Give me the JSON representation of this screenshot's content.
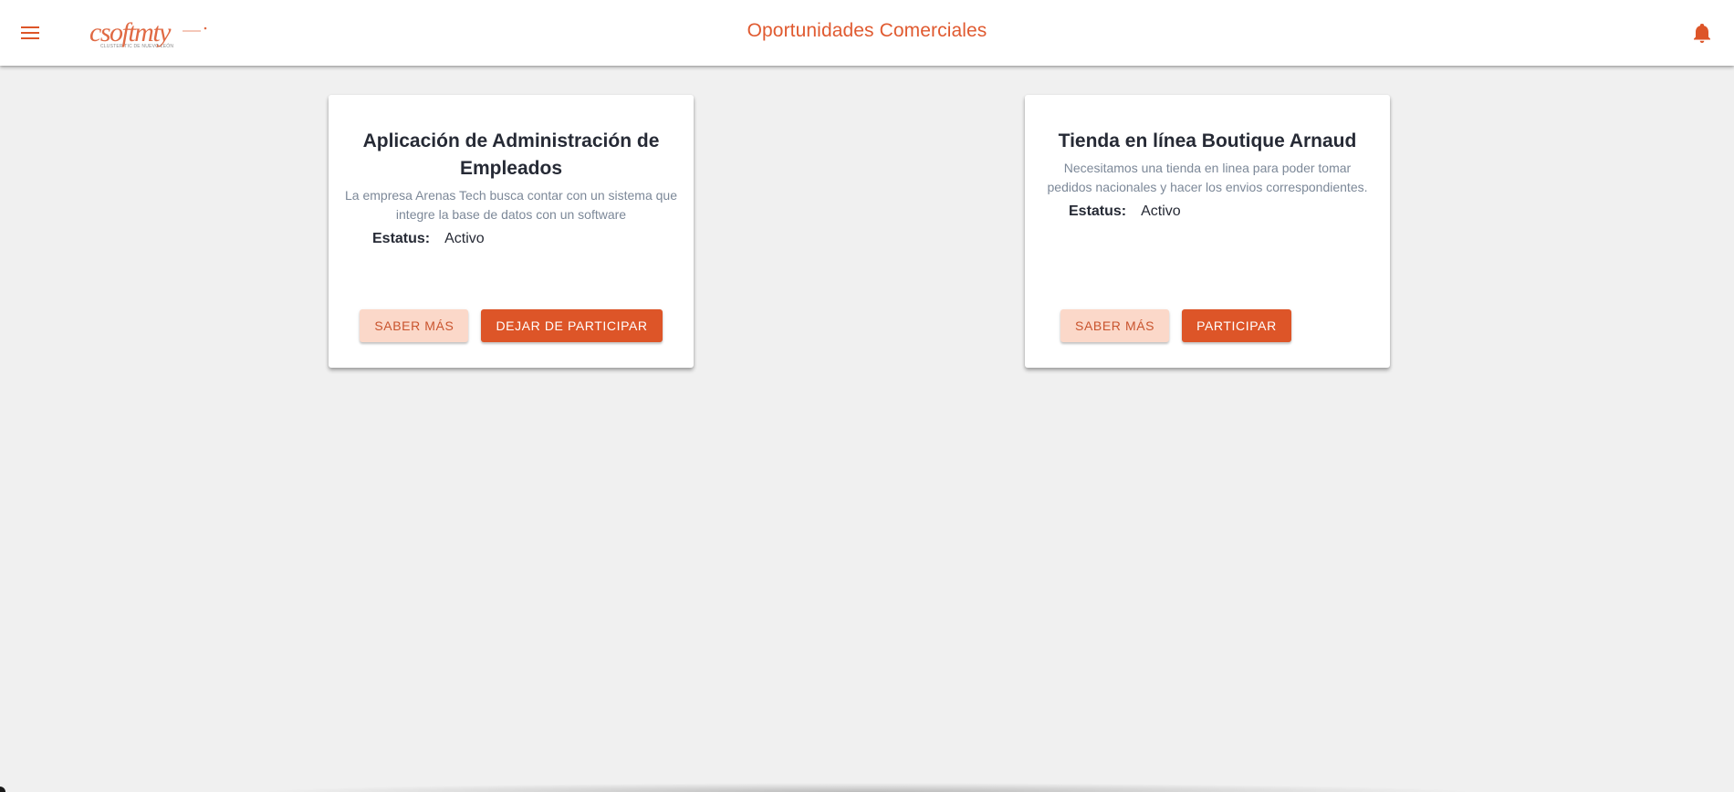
{
  "header": {
    "title": "Oportunidades Comerciales",
    "menu_icon": "menu-icon",
    "notification_icon": "bell-icon",
    "logo": {
      "text": "csoftmty",
      "tagline": "CLUSTER TIC DE NUEVO LEÓN"
    }
  },
  "colors": {
    "brand": "#dd5528",
    "title": "#e05a30",
    "light_button": "#fbd8c9",
    "background": "#f0f0f0"
  },
  "opportunities": [
    {
      "title": "Aplicación de Administración de Empleados",
      "description": "La empresa Arenas Tech busca contar con un sistema que integre la base de datos con un software",
      "status_label": "Estatus:",
      "status_value": "Activo",
      "more_label": "Saber más",
      "action_label": "Dejar de participar"
    },
    {
      "title": "Tienda en línea Boutique Arnaud",
      "description": "Necesitamos una tienda en linea para poder tomar pedidos nacionales y hacer los envios correspondientes.",
      "status_label": "Estatus:",
      "status_value": "Activo",
      "more_label": "Saber más",
      "action_label": "Participar"
    }
  ]
}
